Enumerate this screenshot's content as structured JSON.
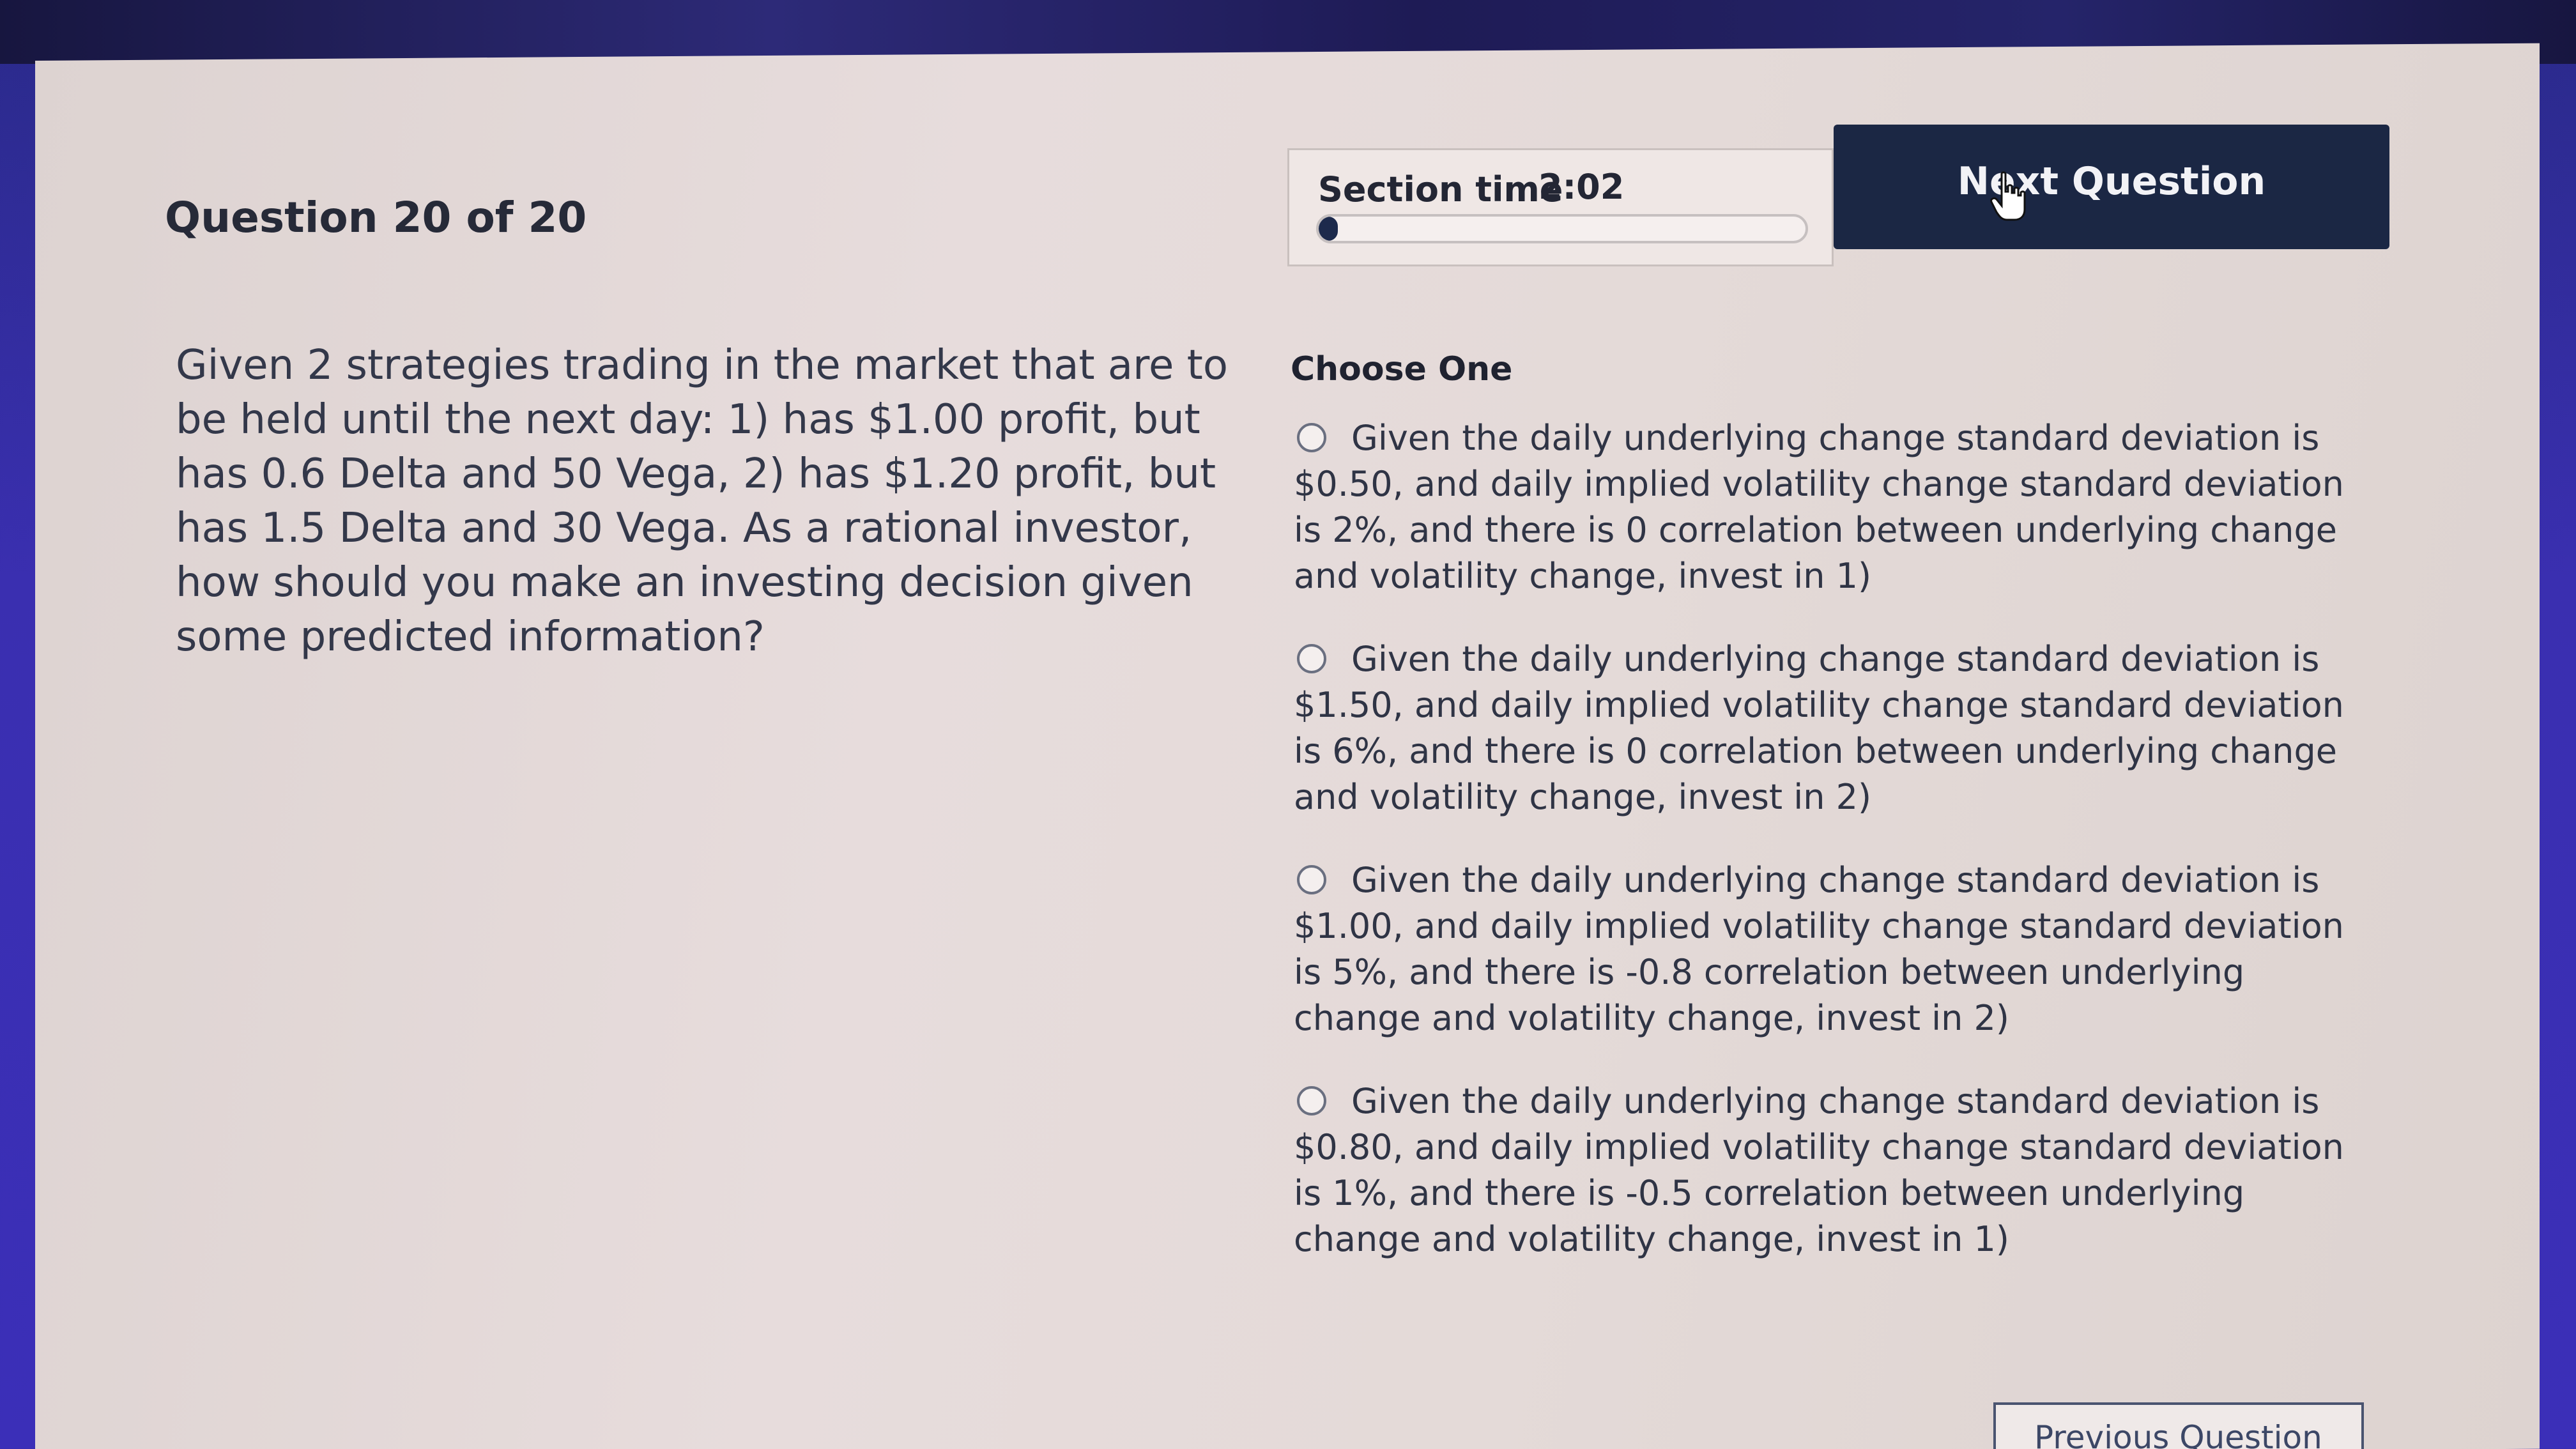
{
  "header": {
    "question_counter": "Question 20 of 20",
    "timer_label": "Section time",
    "timer_value": "2:02",
    "timer_progress": 0.02,
    "next_button_label": "Next Question"
  },
  "question": {
    "text": "Given 2 strategies trading in the market that are to be held until the next day: 1) has $1.00 profit, but has 0.6 Delta and 50 Vega, 2) has $1.20 profit, but has 1.5 Delta and 30 Vega. As a rational investor, how should you make an investing decision given some predicted information?"
  },
  "answers": {
    "choose_label": "Choose One",
    "options": [
      {
        "label": "Given the daily underlying change standard deviation is $0.50, and daily implied volatility change standard deviation is 2%, and there is 0 correlation between underlying change and volatility change, invest in 1)",
        "selected": false
      },
      {
        "label": "Given the daily underlying change standard deviation is $1.50, and daily implied volatility change standard deviation is 6%, and there is 0 correlation between underlying change and volatility change, invest in 2)",
        "selected": false
      },
      {
        "label": "Given the daily underlying change standard deviation is $1.00, and daily implied volatility change standard deviation is 5%, and there is -0.8 correlation between underlying change and volatility change, invest in 2)",
        "selected": false
      },
      {
        "label": "Given the daily underlying change standard deviation is $0.80, and daily implied volatility change standard deviation is 1%, and there is -0.5 correlation between underlying change and volatility change, invest in 1)",
        "selected": false
      }
    ]
  },
  "footer": {
    "previous_button_label": "Previous Question"
  },
  "colors": {
    "primary_button": "#1b2744",
    "panel_background": "#e4dad8"
  },
  "icons": {
    "cursor": "hand-pointer-icon",
    "radio": "radio-unchecked-icon"
  }
}
